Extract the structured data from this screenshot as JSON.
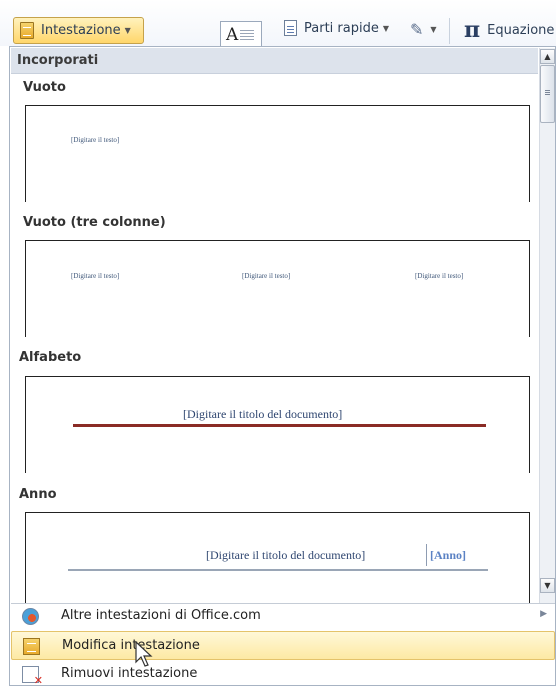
{
  "ribbon": {
    "header_button_label": "Intestazione",
    "textbox_glyph": "A",
    "quick_parts_label": "Parti rapide",
    "equation_glyph": "π",
    "equation_label": "Equazione"
  },
  "gallery": {
    "category": "Incorporati",
    "sections": [
      {
        "title": "Vuoto",
        "placeholder": "[Digitare il testo]"
      },
      {
        "title": "Vuoto (tre colonne)",
        "placeholders": [
          "[Digitare il testo]",
          "[Digitare il testo]",
          "[Digitare il testo]"
        ]
      },
      {
        "title": "Alfabeto",
        "placeholder": "[Digitare il titolo del documento]"
      },
      {
        "title": "Anno",
        "placeholder": "[Digitare il titolo del documento]",
        "year": "[Anno]"
      }
    ]
  },
  "menu": {
    "more_headers": "Altre intestazioni di Office.com",
    "edit_header": "Modifica intestazione",
    "remove_header": "Rimuovi intestazione"
  },
  "colors": {
    "hover_bg": "#fdeaa8",
    "alfabeto_rule": "#8a2b25",
    "anno_year": "#5b82c4"
  }
}
